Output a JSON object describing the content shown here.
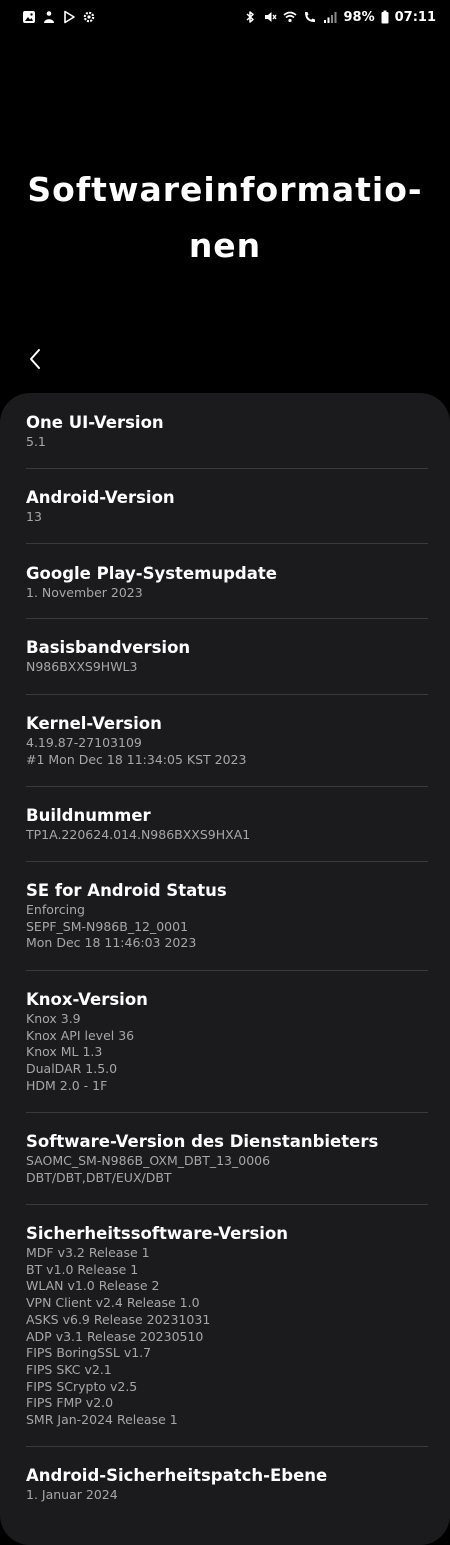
{
  "status_bar": {
    "left_icons": [
      "gallery-icon",
      "app-notification-icon",
      "play-store-icon",
      "settings-gear-icon"
    ],
    "right_icons": [
      "bluetooth-icon",
      "mute-icon",
      "wifi-icon",
      "wifi-calling-icon",
      "signal-icon"
    ],
    "battery": "98%",
    "time": "07:11"
  },
  "header": {
    "title_line1": "Softwareinformatio-",
    "title_line2": "nen",
    "back_icon": "chevron-left-icon"
  },
  "items": [
    {
      "title": "One UI-Version",
      "values": [
        "5.1"
      ]
    },
    {
      "title": "Android-Version",
      "values": [
        "13"
      ]
    },
    {
      "title": "Google Play-Systemupdate",
      "values": [
        "1. November 2023"
      ]
    },
    {
      "title": "Basisbandversion",
      "values": [
        "N986BXXS9HWL3"
      ]
    },
    {
      "title": "Kernel-Version",
      "values": [
        "4.19.87-27103109",
        "#1 Mon Dec 18 11:34:05 KST 2023"
      ]
    },
    {
      "title": "Buildnummer",
      "values": [
        "TP1A.220624.014.N986BXXS9HXA1"
      ]
    },
    {
      "title": "SE for Android Status",
      "values": [
        "Enforcing",
        "SEPF_SM-N986B_12_0001",
        "Mon Dec 18 11:46:03 2023"
      ]
    },
    {
      "title": "Knox-Version",
      "values": [
        "Knox 3.9",
        "Knox API level 36",
        "Knox ML 1.3",
        "DualDAR 1.5.0",
        "HDM 2.0 - 1F"
      ]
    },
    {
      "title": "Software-Version des Dienstanbieters",
      "values": [
        "SAOMC_SM-N986B_OXM_DBT_13_0006",
        "DBT/DBT,DBT/EUX/DBT"
      ]
    },
    {
      "title": "Sicherheitssoftware-Version",
      "values": [
        "MDF v3.2 Release 1",
        "BT v1.0 Release 1",
        "WLAN v1.0 Release 2",
        "VPN Client v2.4 Release 1.0",
        "ASKS v6.9 Release 20231031",
        "ADP v3.1 Release 20230510",
        "FIPS BoringSSL v1.7",
        "FIPS SKC v2.1",
        "FIPS SCrypto v2.5",
        "FIPS FMP v2.0",
        "SMR Jan-2024 Release 1"
      ]
    },
    {
      "title": "Android-Sicherheitspatch-Ebene",
      "values": [
        "1. Januar 2024"
      ]
    }
  ],
  "colors": {
    "background": "#000000",
    "card": "#1b1b1d",
    "title_text": "#ffffff",
    "value_text": "#a7a7a7",
    "divider": "#3a3a3c"
  }
}
